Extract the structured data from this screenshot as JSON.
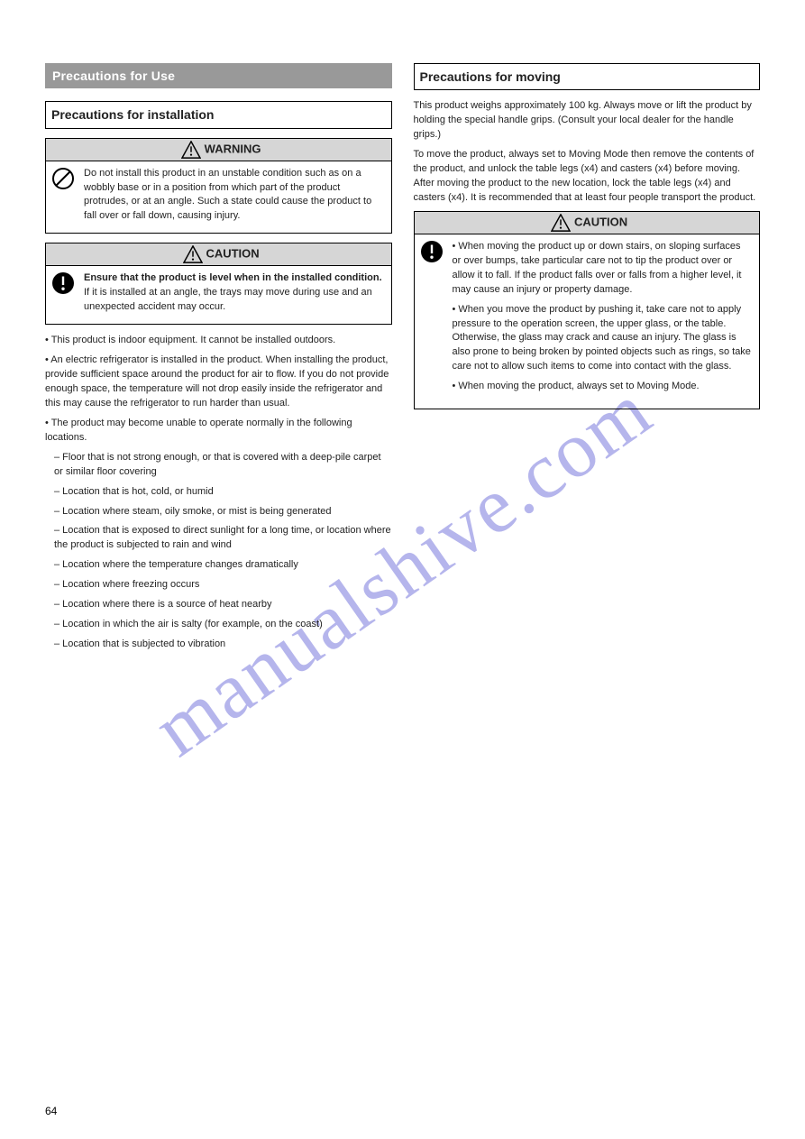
{
  "watermark": "manualshive.com",
  "pageNumber": "64",
  "left": {
    "sectionTitle": "Precautions for Use",
    "subheading": "Precautions for installation",
    "warning": {
      "label": "WARNING",
      "text": "Do not install this product in an unstable condition such as on a wobbly base or in a position from which part of the product protrudes, or at an angle. Such a state could cause the product to fall over or fall down, causing injury."
    },
    "caution": {
      "label": "CAUTION",
      "lead": "Ensure that the product is level when in the installed condition.",
      "text": "If it is installed at an angle, the trays may move during use and an unexpected accident may occur."
    },
    "notes": [
      "• This product is indoor equipment. It cannot be installed outdoors.",
      "• An electric refrigerator is installed in the product. When installing the product, provide sufficient space around the product for air to flow. If you do not provide enough space, the temperature will not drop easily inside the refrigerator and this may cause the refrigerator to run harder than usual.",
      "• The product may become unable to operate normally in the following locations.",
      "– Floor that is not strong enough, or that is covered with a deep-pile carpet or similar floor covering",
      "– Location that is hot, cold, or humid",
      "– Location where steam, oily smoke, or mist is being generated",
      "– Location that is exposed to direct sunlight for a long time, or location where the product is subjected to rain and wind",
      "– Location where the temperature changes dramatically",
      "– Location where freezing occurs",
      "– Location where there is a source of heat nearby",
      "– Location in which the air is salty (for example, on the coast)",
      "– Location that is subjected to vibration"
    ]
  },
  "right": {
    "subheading": "Precautions for moving",
    "paragraphs": [
      "This product weighs approximately 100 kg. Always move or lift the product by holding the special handle grips. (Consult your local dealer for the handle grips.)",
      "To move the product, always set to Moving Mode then remove the contents of the product, and unlock the table legs (x4) and casters (x4) before moving. After moving the product to the new location, lock the table legs (x4) and casters (x4). It is recommended that at least four people transport the product."
    ],
    "caution": {
      "label": "CAUTION",
      "items": [
        "• When moving the product up or down stairs, on sloping surfaces or over bumps, take particular care not to tip the product over or allow it to fall. If the product falls over or falls from a higher level, it may cause an injury or property damage.",
        "• When you move the product by pushing it, take care not to apply pressure to the operation screen, the upper glass, or the table. Otherwise, the glass may crack and cause an injury. The glass is also prone to being broken by pointed objects such as rings, so take care not to allow such items to come into contact with the glass.",
        "• When moving the product, always set to Moving Mode."
      ]
    }
  }
}
